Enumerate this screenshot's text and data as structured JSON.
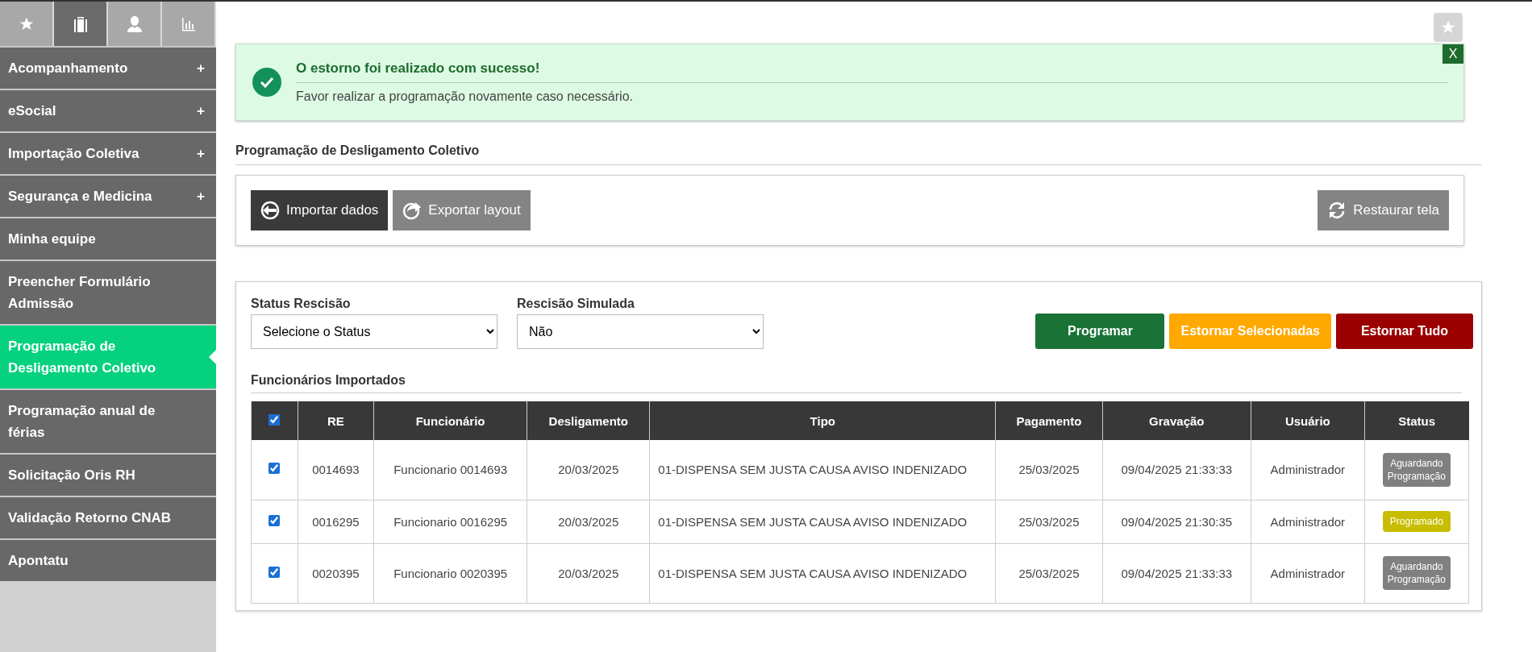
{
  "sidebar": {
    "tabs": [
      {
        "kind": "star",
        "selected": false
      },
      {
        "kind": "briefcase",
        "selected": true
      },
      {
        "kind": "person",
        "selected": false
      },
      {
        "kind": "chart",
        "selected": false
      }
    ],
    "items": [
      {
        "label": "Acompanhamento",
        "expander": "+",
        "selected": false
      },
      {
        "label": "eSocial",
        "expander": "+",
        "selected": false
      },
      {
        "label": "Importação Coletiva",
        "expander": "+",
        "selected": false
      },
      {
        "label": "Segurança e Medicina",
        "expander": "+",
        "selected": false
      },
      {
        "label": "Minha equipe",
        "selected": false
      },
      {
        "label": "Preencher Formulário Admissão",
        "selected": false
      },
      {
        "label": "Programação de Desligamento Coletivo",
        "selected": true
      },
      {
        "label": "Programação anual de férias",
        "selected": false
      },
      {
        "label": "Solicitação Oris RH",
        "selected": false
      },
      {
        "label": "Validação Retorno CNAB",
        "selected": false
      },
      {
        "label": "Apontatu",
        "selected": false
      }
    ]
  },
  "alert": {
    "title": "O estorno foi realizado com sucesso!",
    "message": "Favor realizar a programação novamente caso necessário.",
    "close": "X"
  },
  "section_title": "Programação de Desligamento Coletivo",
  "toolbar": {
    "buttons": [
      {
        "label": "Importar dados",
        "kind": "import"
      },
      {
        "label": "Exportar layout",
        "kind": "export"
      }
    ],
    "restore": {
      "label": "Restaurar tela"
    }
  },
  "filters": [
    {
      "label": "Status Rescisão",
      "value": "Selecione o Status"
    },
    {
      "label": "Rescisão Simulada",
      "value": "Não"
    }
  ],
  "actions": [
    {
      "label": "Programar",
      "kind": "green"
    },
    {
      "label": "Estornar Selecionadas",
      "kind": "orange"
    },
    {
      "label": "Estornar Tudo",
      "kind": "red"
    }
  ],
  "table": {
    "title": "Funcionários Importados",
    "select_all_checked": true,
    "columns": [
      "RE",
      "Funcionário",
      "Desligamento",
      "Tipo",
      "Pagamento",
      "Gravação",
      "Usuário",
      "Status"
    ],
    "rows": [
      {
        "checked": true,
        "cells": [
          "0014693",
          "Funcionario 0014693",
          "20/03/2025",
          "01-DISPENSA SEM JUSTA CAUSA AVISO INDENIZADO",
          "25/03/2025",
          "09/04/2025 21:33:33",
          "Administrador"
        ],
        "status": {
          "label": "Aguardando Programação",
          "color": "#808080"
        }
      },
      {
        "checked": true,
        "cells": [
          "0016295",
          "Funcionario 0016295",
          "20/03/2025",
          "01-DISPENSA SEM JUSTA CAUSA AVISO INDENIZADO",
          "25/03/2025",
          "09/04/2025 21:30:35",
          "Administrador"
        ],
        "status": {
          "label": "Programado",
          "color": "#c8bd00"
        }
      },
      {
        "checked": true,
        "cells": [
          "0020395",
          "Funcionario 0020395",
          "20/03/2025",
          "01-DISPENSA SEM JUSTA CAUSA AVISO INDENIZADO",
          "25/03/2025",
          "09/04/2025 21:33:33",
          "Administrador"
        ],
        "status": {
          "label": "Aguardando Programação",
          "color": "#808080"
        }
      }
    ]
  }
}
